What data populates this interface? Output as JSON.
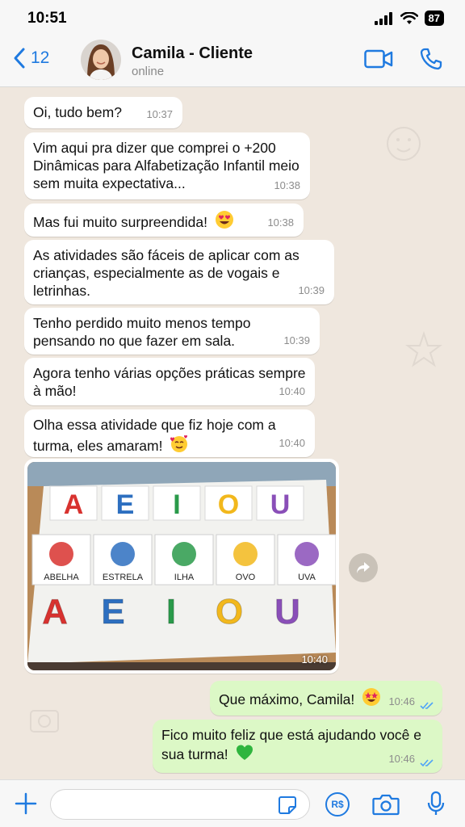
{
  "status_bar": {
    "time": "10:51",
    "battery": "87"
  },
  "header": {
    "back_count": "12",
    "contact_name": "Camila - Cliente",
    "contact_status": "online"
  },
  "messages": [
    {
      "text": "Oi, tudo bem?",
      "time": "10:37",
      "direction": "in"
    },
    {
      "text": "Vim aqui pra dizer que comprei o +200 Dinâmicas para Alfabetização Infantil meio sem muita expectativa...",
      "time": "10:38",
      "direction": "in"
    },
    {
      "text": "Mas fui muito surpreendida!",
      "time": "10:38",
      "direction": "in",
      "emoji": "heart-eyes"
    },
    {
      "text": "As atividades são fáceis de aplicar com as crianças, especialmente as de vogais e letrinhas.",
      "time": "10:39",
      "direction": "in"
    },
    {
      "text": "Tenho perdido muito menos tempo pensando no que fazer em sala.",
      "time": "10:39",
      "direction": "in"
    },
    {
      "text": "Agora tenho várias opções práticas sempre à mão!",
      "time": "10:40",
      "direction": "in"
    },
    {
      "text": "Olha essa atividade que fiz hoje com a turma, eles amaram!",
      "time": "10:40",
      "direction": "in",
      "emoji": "smiling-hearts"
    },
    {
      "text": "Que máximo, Camila!",
      "time": "10:46",
      "direction": "out",
      "emoji": "star-struck"
    },
    {
      "text": "Fico muito feliz que está ajudando você e sua turma!",
      "time": "10:46",
      "direction": "out",
      "emoji": "green-heart"
    }
  ],
  "image_message": {
    "time": "10:40",
    "vowels": [
      "A",
      "E",
      "I",
      "O",
      "U"
    ],
    "vowel_colors": [
      "#d8322f",
      "#2d6fc0",
      "#2a9a4a",
      "#f2b81c",
      "#8a4fb8"
    ],
    "cards": [
      "ABELHA",
      "ESTRELA",
      "ILHA",
      "OVO",
      "UVA"
    ]
  },
  "input": {
    "placeholder": ""
  },
  "colors": {
    "accent": "#1f7ae0",
    "outgoing_bubble": "#dcf8c6",
    "chat_background": "#efe7de"
  }
}
